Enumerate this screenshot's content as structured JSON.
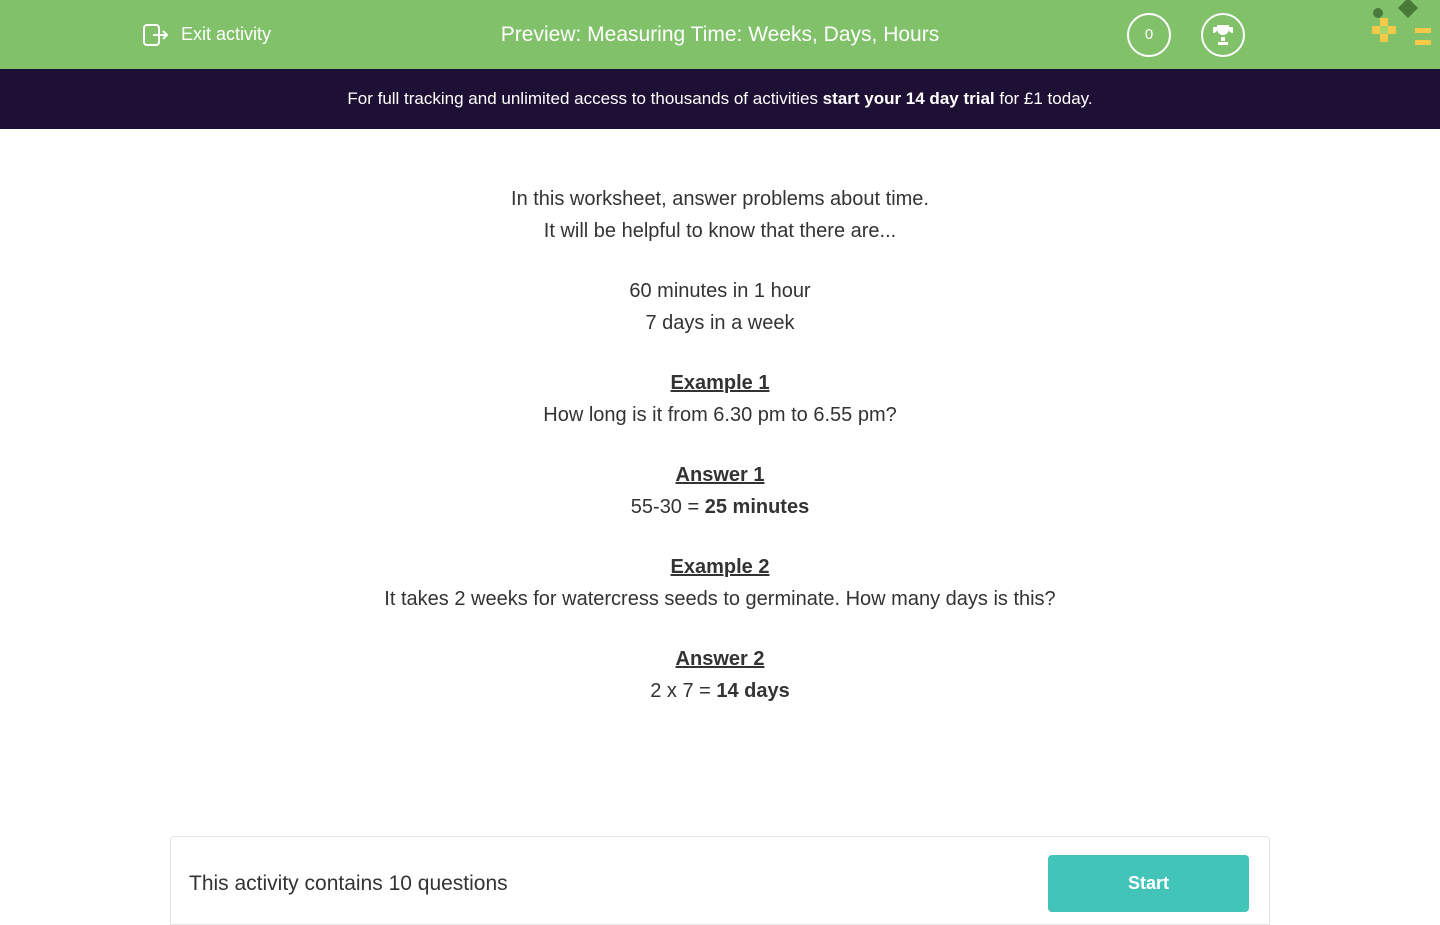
{
  "header": {
    "exit_label": "Exit activity",
    "title": "Preview: Measuring Time: Weeks, Days, Hours",
    "score": "0"
  },
  "promo": {
    "prefix": "For full tracking and unlimited access to thousands of activities ",
    "bold": "start your 14 day trial",
    "suffix": " for £1 today."
  },
  "content": {
    "intro1": "In this worksheet, answer problems about time.",
    "intro2": "It will be helpful to know that there are...",
    "fact1": "60 minutes in 1 hour",
    "fact2": "7 days in a week",
    "example1_heading": "Example 1",
    "example1_text": "How long is it from 6.30 pm to 6.55 pm?",
    "answer1_heading": "Answer 1",
    "answer1_prefix": "55-30 = ",
    "answer1_bold": "25 minutes",
    "example2_heading": "Example 2",
    "example2_text": "It takes 2 weeks for watercress seeds to germinate.  How many days is this?",
    "answer2_heading": "Answer 2",
    "answer2_prefix": "2 x 7 = ",
    "answer2_bold": "14 days"
  },
  "footer": {
    "text": "This activity contains 10 questions",
    "button": "Start"
  }
}
